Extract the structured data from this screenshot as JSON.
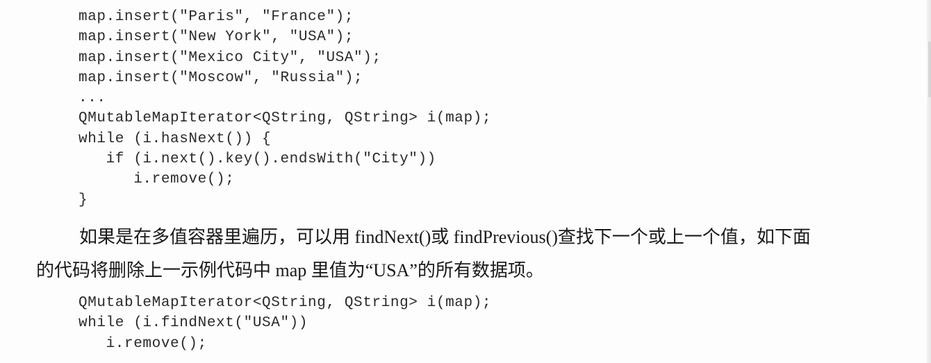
{
  "code_block_1": {
    "lines": [
      "map.insert(\"Paris\", \"France\");",
      "map.insert(\"New York\", \"USA\");",
      "map.insert(\"Mexico City\", \"USA\");",
      "map.insert(\"Moscow\", \"Russia\");",
      "...",
      "QMutableMapIterator<QString, QString> i(map);",
      "while (i.hasNext()) {",
      "   if (i.next().key().endsWith(\"City\"))",
      "      i.remove();",
      "}"
    ]
  },
  "paragraph": {
    "line1": "如果是在多值容器里遍历，可以用 findNext()或 findPrevious()查找下一个或上一个值，如下面",
    "line2": "的代码将删除上一示例代码中 map 里值为“USA”的所有数据项。"
  },
  "code_block_2": {
    "lines": [
      "QMutableMapIterator<QString, QString> i(map);",
      "while (i.findNext(\"USA\"))",
      "   i.remove();"
    ]
  }
}
